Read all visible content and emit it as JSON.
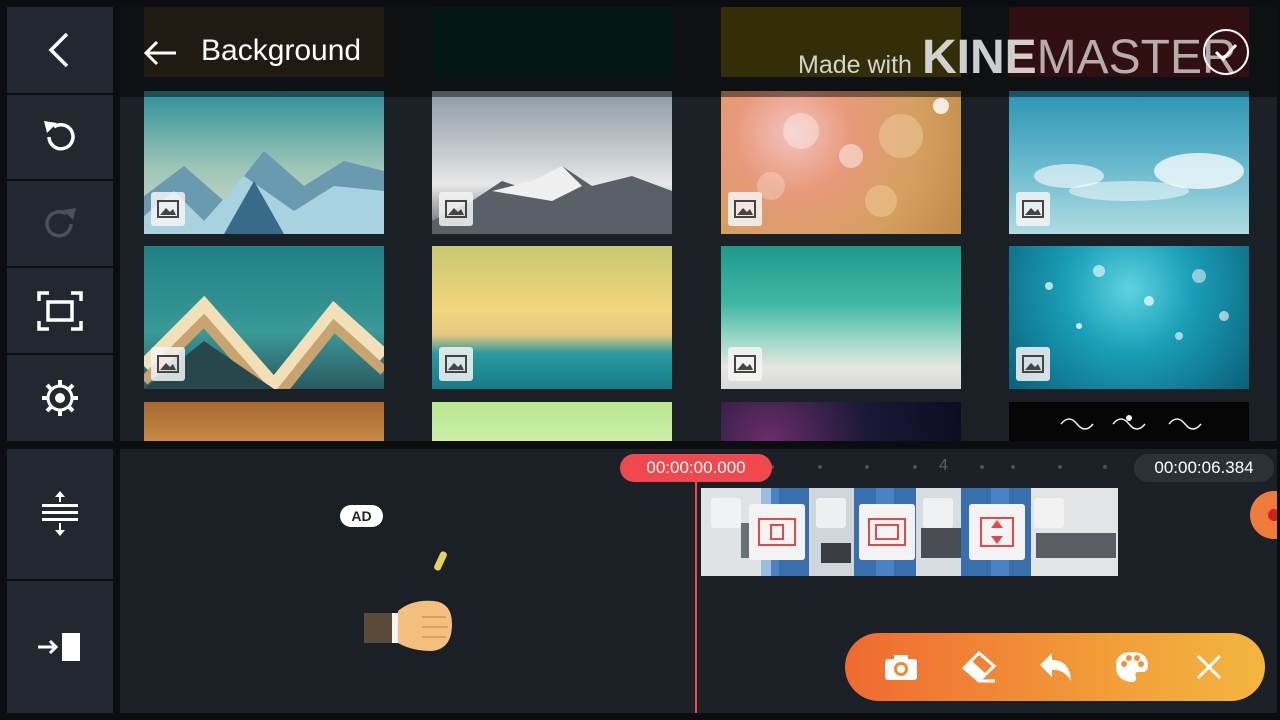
{
  "header": {
    "title": "Background"
  },
  "watermark": {
    "made_with": "Made with",
    "brand_bold": "KINE",
    "brand_light": "MASTER"
  },
  "sidebar": {
    "items": [
      {
        "icon": "back-chevron-icon"
      },
      {
        "icon": "undo-icon"
      },
      {
        "icon": "redo-icon",
        "disabled": true
      },
      {
        "icon": "fit-screen-icon"
      },
      {
        "icon": "settings-gear-icon"
      },
      {
        "icon": "track-adjust-icon"
      },
      {
        "icon": "jump-to-end-icon"
      }
    ]
  },
  "thumbnails": {
    "row_top_partial": [
      "color-swatch-brown",
      "color-swatch-dark-teal",
      "color-swatch-yellow",
      "color-swatch-red"
    ],
    "row1": [
      "low-poly-mountains",
      "snowy-mountain-peaks",
      "bokeh-lights",
      "blue-sky-clouds"
    ],
    "row2": [
      "teal-geometric-peaks",
      "sunset-sea-horizon",
      "ocean-wave-beach",
      "water-bubbles"
    ],
    "row3_partial": [
      "warm-orange-blur",
      "light-green-texture",
      "dark-purple-glow",
      "black-ornament"
    ]
  },
  "timeline": {
    "current_time": "00:00:00.000",
    "end_time": "00:00:06.384",
    "ruler_mark": "4",
    "ad_badge": "AD"
  },
  "toolbar": {
    "items": [
      "camera-icon",
      "eraser-icon",
      "undo-arrow-icon",
      "palette-icon",
      "close-icon"
    ]
  },
  "colors": {
    "accent": "#f0484d",
    "toolbar_start": "#ef6a30",
    "toolbar_end": "#f3b640",
    "panel": "#1b2026"
  }
}
